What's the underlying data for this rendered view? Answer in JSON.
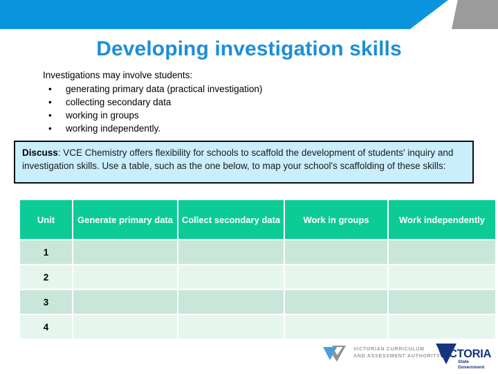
{
  "slide": {
    "title": "Developing investigation skills",
    "header": {
      "banner_blue": "#0b94de",
      "banner_gray": "#9b9b9b"
    },
    "intro": {
      "lead": "Investigations may involve students:",
      "bullet_glyph": "•",
      "bullets": [
        "generating primary data (practical investigation)",
        "collecting secondary data",
        "working in groups",
        "working independently."
      ]
    },
    "discuss": {
      "label": "Discuss",
      "body": ": VCE Chemistry offers flexibility for schools to scaffold the development of students' inquiry and investigation skills. Use a table, such as the one below, to map your school's scaffolding of these skills:",
      "background": "#c9eefc",
      "border_color": "#0d0d0d"
    },
    "table": {
      "header_color": "#0ccb96",
      "row_odd_color": "#c8e7da",
      "row_even_color": "#e7f5ef",
      "columns": [
        "Unit",
        "Generate primary data",
        "Collect secondary data",
        "Work in groups",
        "Work independently"
      ],
      "rows": [
        {
          "unit": "1",
          "generate_primary_data": "",
          "collect_secondary_data": "",
          "work_in_groups": "",
          "work_independently": ""
        },
        {
          "unit": "2",
          "generate_primary_data": "",
          "collect_secondary_data": "",
          "work_in_groups": "",
          "work_independently": ""
        },
        {
          "unit": "3",
          "generate_primary_data": "",
          "collect_secondary_data": "",
          "work_in_groups": "",
          "work_independently": ""
        },
        {
          "unit": "4",
          "generate_primary_data": "",
          "collect_secondary_data": "",
          "work_in_groups": "",
          "work_independently": ""
        }
      ]
    },
    "footer": {
      "vcaa": {
        "line1": "VICTORIAN CURRICULUM",
        "line2": "AND ASSESSMENT AUTHORITY",
        "text_color": "#9a9a9a"
      },
      "victoria": {
        "wordmark": "VICTORIA",
        "sub_line1": "State",
        "sub_line2": "Government",
        "color": "#15357e"
      }
    }
  }
}
